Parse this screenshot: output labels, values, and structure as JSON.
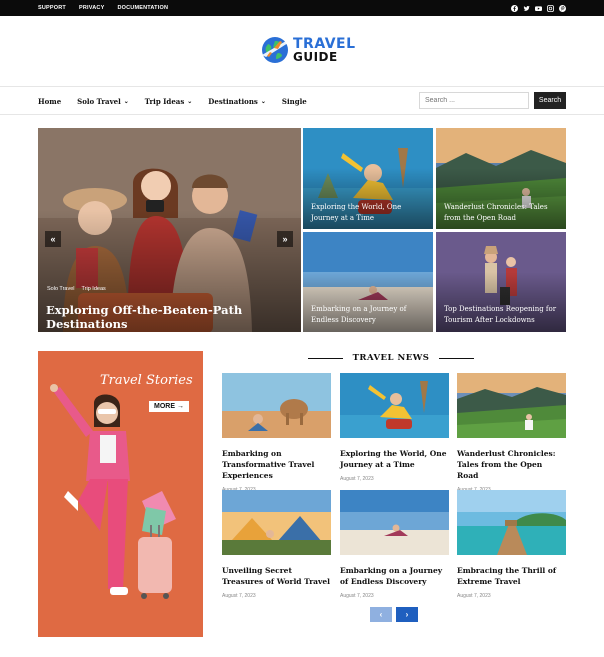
{
  "topbar": {
    "links": [
      "SUPPORT",
      "PRIVACY",
      "DOCUMENTATION"
    ],
    "social_icons": [
      "facebook-icon",
      "twitter-icon",
      "youtube-icon",
      "instagram-icon",
      "pinterest-icon"
    ]
  },
  "logo": {
    "line1": "TRAVEL",
    "line2": "GUIDE"
  },
  "nav": {
    "items": [
      {
        "label": "Home",
        "dropdown": false
      },
      {
        "label": "Solo Travel",
        "dropdown": true
      },
      {
        "label": "Trip Ideas",
        "dropdown": true
      },
      {
        "label": "Destinations",
        "dropdown": true
      },
      {
        "label": "Single",
        "dropdown": false
      }
    ],
    "search_placeholder": "Search ...",
    "search_button": "Search"
  },
  "hero": {
    "main": {
      "tags": [
        "Solo Travel",
        "Trip Ideas"
      ],
      "title": "Exploring Off-the-Beaten-Path Destinations",
      "prev": "«",
      "next": "»"
    },
    "tiles": [
      {
        "title": "Exploring the World, One Journey at a Time"
      },
      {
        "title": "Wanderlust Chronicles: Tales from the Open Road"
      },
      {
        "title": "Embarking on a Journey of Endless Discovery"
      },
      {
        "title": "Top Destinations Reopening for Tourism After Lockdowns"
      }
    ]
  },
  "ad": {
    "title": "Travel Stories",
    "more": "MORE →"
  },
  "travel_news": {
    "heading": "TRAVEL NEWS",
    "cards": [
      {
        "title": "Embarking on Transformative Travel Experiences",
        "date": "August 7, 2023"
      },
      {
        "title": "Exploring the World, One Journey at a Time",
        "date": "August 7, 2023"
      },
      {
        "title": "Wanderlust Chronicles: Tales from the Open Road",
        "date": "August 7, 2023"
      },
      {
        "title": "Unveiling Secret Treasures of World Travel",
        "date": "August 7, 2023"
      },
      {
        "title": "Embarking on a Journey of Endless Discovery",
        "date": "August 7, 2023"
      },
      {
        "title": "Embracing the Thrill of Extreme Travel",
        "date": "August 7, 2023"
      }
    ],
    "pager_prev": "‹",
    "pager_next": "›"
  },
  "colors": {
    "accent": "#1f5fbf",
    "pager_disabled": "#8fb0e0",
    "topbar": "#0b0b0b",
    "ad_bg": "#df6a43"
  }
}
